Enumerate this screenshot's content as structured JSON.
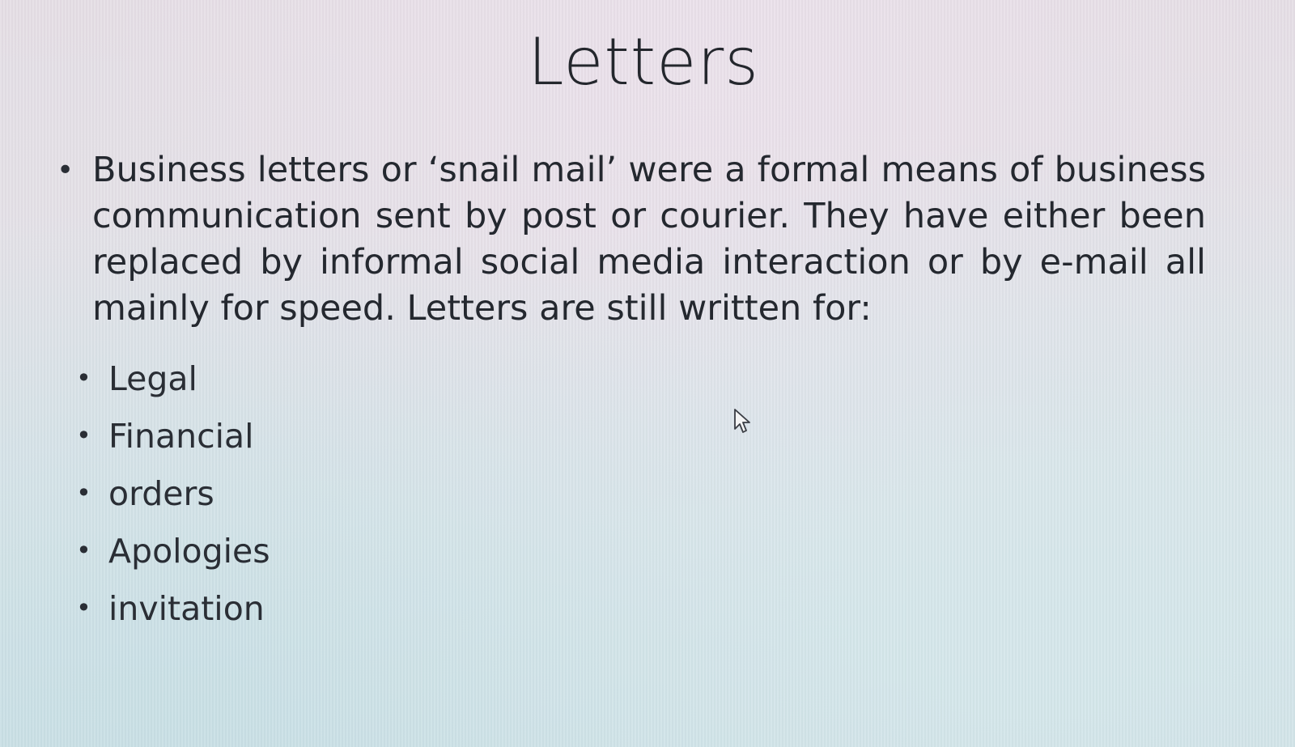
{
  "slide": {
    "title": "Letters",
    "main_bullet": "Business letters or ‘snail mail’ were a formal means of business communication sent by post or courier. They have either been replaced by informal social media interaction or by e-mail all mainly for speed. Letters are still written for:",
    "sub_bullets": [
      "Legal",
      "Financial",
      "orders",
      "Apologies",
      "invitation"
    ],
    "bullet_glyph": "•"
  },
  "icons": {
    "cursor": "mouse-pointer-icon"
  }
}
